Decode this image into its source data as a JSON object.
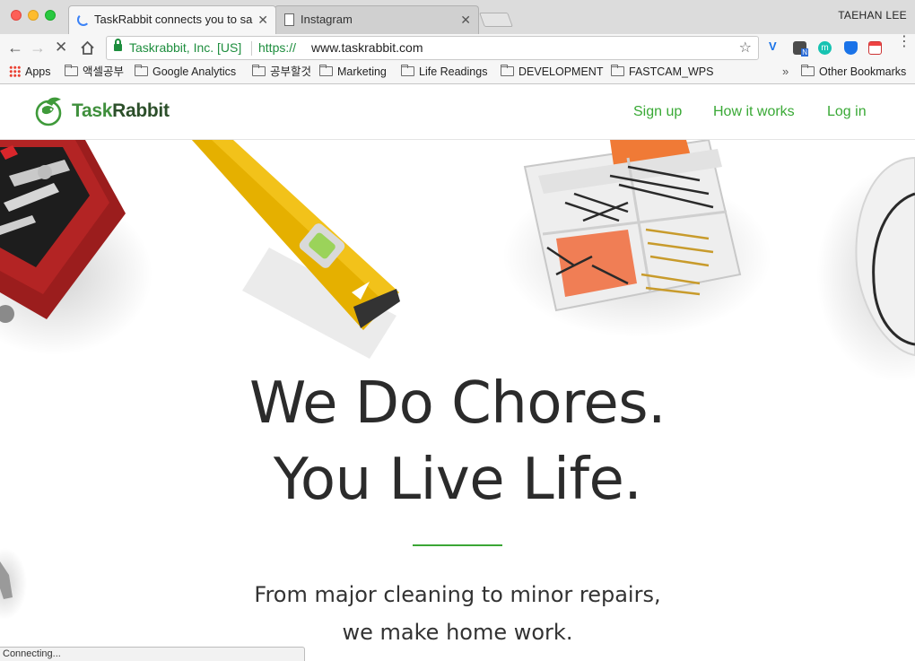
{
  "browser": {
    "tabs": [
      {
        "title": "TaskRabbit connects you to sa",
        "active": true
      },
      {
        "title": "Instagram",
        "active": false
      }
    ],
    "profile_name": "TAEHAN LEE",
    "address_bar": {
      "security_label": "Taskrabbit, Inc. [US]",
      "scheme": "https://",
      "host": "www.taskrabbit.com"
    },
    "bookmarks": [
      {
        "label": "Apps",
        "icon": "apps-grid-icon"
      },
      {
        "label": "액셀공부",
        "icon": "folder-icon"
      },
      {
        "label": "Google Analytics",
        "icon": "folder-icon"
      },
      {
        "label": "공부할것",
        "icon": "folder-icon"
      },
      {
        "label": "Marketing",
        "icon": "folder-icon"
      },
      {
        "label": "Life Readings",
        "icon": "folder-icon"
      },
      {
        "label": "DEVELOPMENT",
        "icon": "folder-icon"
      },
      {
        "label": "FASTCAM_WPS",
        "icon": "folder-icon"
      }
    ],
    "bookmarks_overflow": "»",
    "other_bookmarks": "Other Bookmarks",
    "status_text": "Connecting..."
  },
  "site": {
    "logo_text_light": "Task",
    "logo_text_dark": "Rabbit",
    "nav": {
      "signup": "Sign up",
      "how_it_works": "How it works",
      "login": "Log in"
    },
    "hero": {
      "title_line1": "We Do Chores.",
      "title_line2": "You Live Life.",
      "subtitle_line1": "From major cleaning to minor repairs,",
      "subtitle_line2": "we make home work."
    }
  },
  "colors": {
    "brand_green": "#39a935",
    "secure_green": "#1e8e3e"
  }
}
